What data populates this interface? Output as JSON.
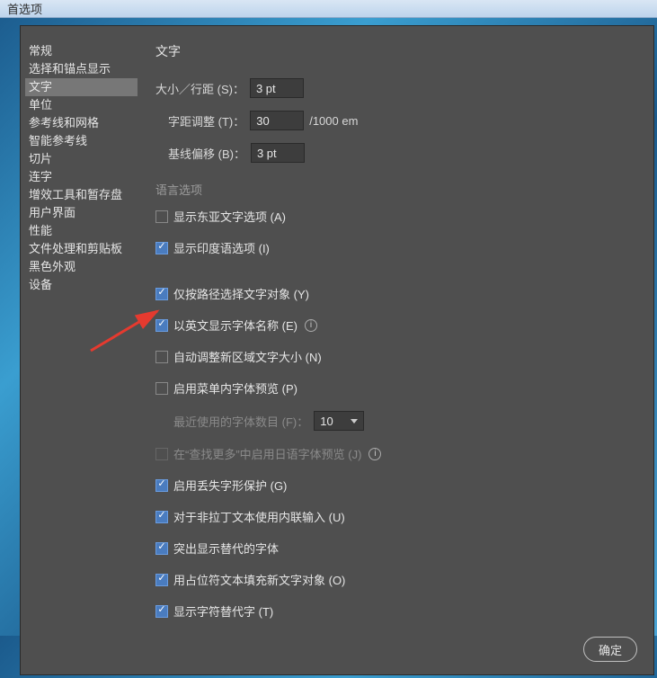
{
  "window": {
    "title": "首选项"
  },
  "sidebar": {
    "items": [
      "常规",
      "选择和锚点显示",
      "文字",
      "单位",
      "参考线和网格",
      "智能参考线",
      "切片",
      "连字",
      "增效工具和暂存盘",
      "用户界面",
      "性能",
      "文件处理和剪贴板",
      "黑色外观",
      "设备"
    ],
    "selectedIndex": 2
  },
  "main": {
    "heading": "文字",
    "sizeLeading": {
      "label": "大小／行距 (S)：",
      "value": "3 pt"
    },
    "tracking": {
      "label": "字距调整 (T)：",
      "value": "30",
      "suffix": "/1000 em"
    },
    "baseline": {
      "label": "基线偏移 (B)：",
      "value": "3 pt"
    },
    "langHead": "语言选项",
    "eastAsian": {
      "label": "显示东亚文字选项 (A)",
      "checked": false
    },
    "indic": {
      "label": "显示印度语选项 (I)",
      "checked": true
    },
    "typeByPath": {
      "label": "仅按路径选择文字对象 (Y)",
      "checked": true
    },
    "engFontName": {
      "label": "以英文显示字体名称 (E)",
      "checked": true
    },
    "autoSizeArea": {
      "label": "自动调整新区域文字大小 (N)",
      "checked": false
    },
    "inMenuPreview": {
      "label": "启用菜单内字体预览 (P)",
      "checked": false
    },
    "recentFonts": {
      "label": "最近使用的字体数目 (F)：",
      "value": "10"
    },
    "jpPreview": {
      "label": "在“查找更多”中启用日语字体预览 (J)",
      "checked": false
    },
    "glyphProtect": {
      "label": "启用丢失字形保护 (G)",
      "checked": true
    },
    "inlineIME": {
      "label": "对于非拉丁文本使用内联输入 (U)",
      "checked": true
    },
    "altGlyphHL": {
      "label": "突出显示替代的字体",
      "checked": true
    },
    "placeholderFill": {
      "label": "用占位符文本填充新文字对象 (O)",
      "checked": true
    },
    "showAltGlyph": {
      "label": "显示字符替代字 (T)",
      "checked": true
    }
  },
  "footer": {
    "ok": "确定"
  }
}
